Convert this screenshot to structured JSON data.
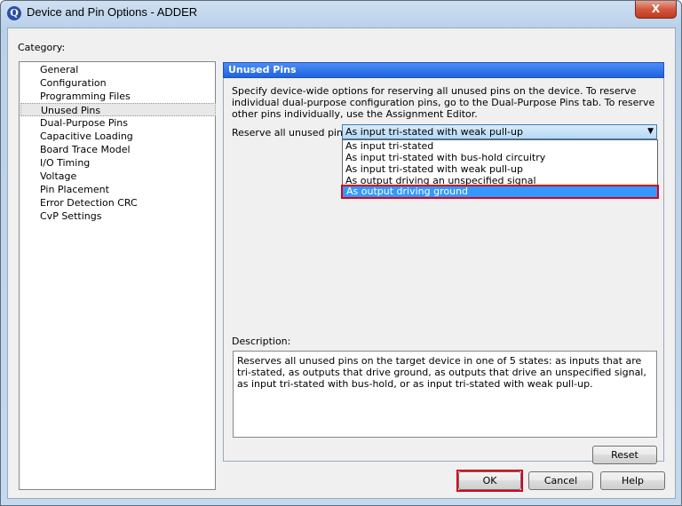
{
  "window": {
    "title": "Device and Pin Options - ADDER",
    "close_glyph": "X",
    "app_icon_glyph": "Q"
  },
  "category": {
    "label": "Category:",
    "items": [
      "General",
      "Configuration",
      "Programming Files",
      "Unused Pins",
      "Dual-Purpose Pins",
      "Capacitive Loading",
      "Board Trace Model",
      "I/O Timing",
      "Voltage",
      "Pin Placement",
      "Error Detection CRC",
      "CvP Settings"
    ],
    "selected": "Unused Pins"
  },
  "panel": {
    "title": "Unused Pins",
    "intro": "Specify device-wide options for reserving all unused pins on the device. To reserve individual dual-purpose configuration pins, go to the Dual-Purpose Pins tab. To reserve other pins individually, use the Assignment Editor.",
    "reserve_label": "Reserve all unused pins:",
    "reserve_value": "As input tri-stated with weak pull-up",
    "options": [
      "As input tri-stated",
      "As input tri-stated with bus-hold circuitry",
      "As input tri-stated with weak pull-up",
      "As output driving an unspecified signal",
      "As output driving ground"
    ],
    "highlighted_option": "As output driving ground",
    "description_label": "Description:",
    "description": "Reserves all unused pins on the target device in one of 5 states: as inputs that are tri-stated, as outputs that drive ground, as outputs that drive an unspecified signal, as input tri-stated with bus-hold, or as input tri-stated with weak pull-up.",
    "reset_label": "Reset"
  },
  "buttons": {
    "ok": "OK",
    "cancel": "Cancel",
    "help": "Help"
  },
  "colors": {
    "panel_header": "#1f63e0",
    "highlight": "#3399ff",
    "annotation_box": "#d8001c"
  }
}
